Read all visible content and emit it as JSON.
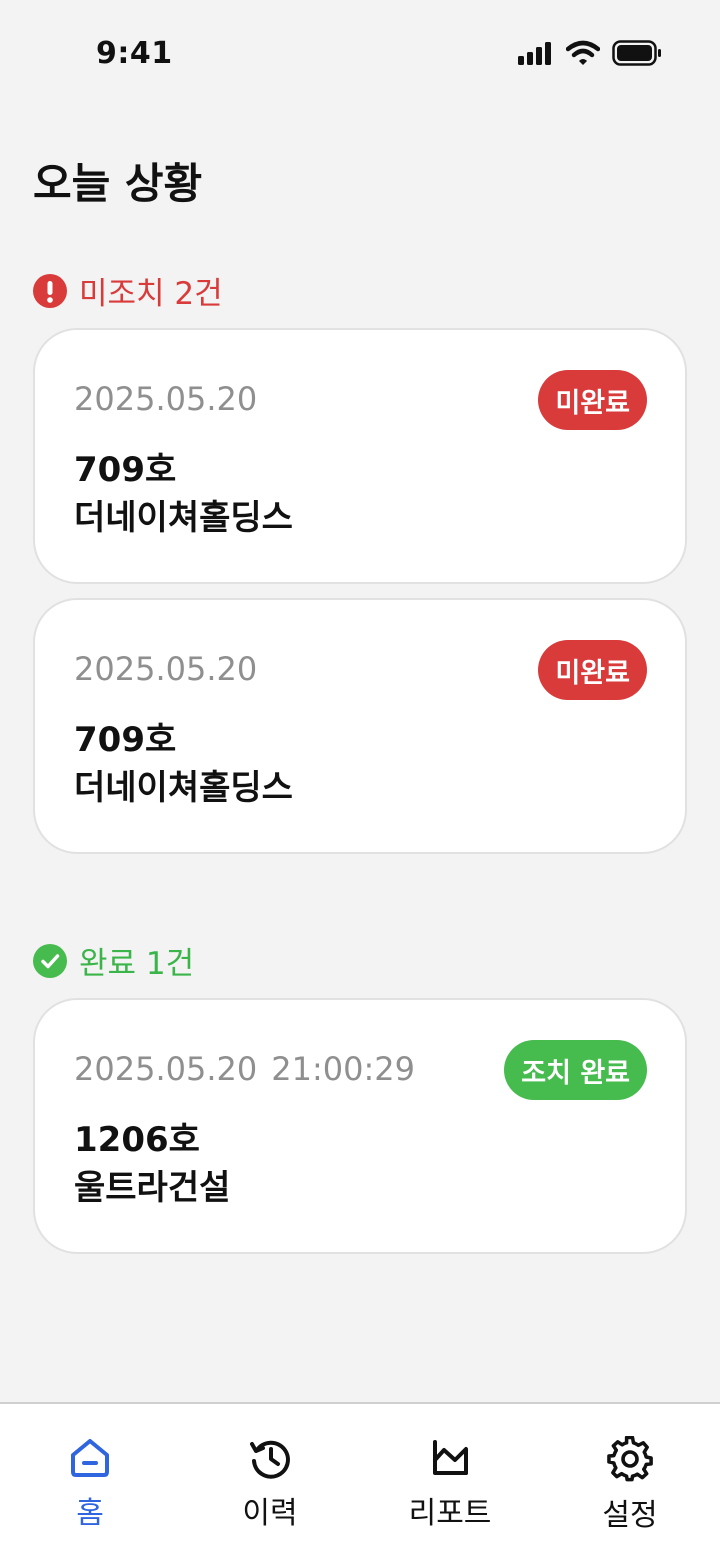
{
  "status_bar": {
    "time": "9:41"
  },
  "page_title": "오늘 상황",
  "pending": {
    "header": "미조치 2건",
    "items": [
      {
        "date": "2025.05.20",
        "room": "709호",
        "company": "더네이쳐홀딩스",
        "badge": "미완료"
      },
      {
        "date": "2025.05.20",
        "room": "709호",
        "company": "더네이쳐홀딩스",
        "badge": "미완료"
      }
    ]
  },
  "done": {
    "header": "완료 1건",
    "items": [
      {
        "date": "2025.05.20",
        "time": "21:00:29",
        "room": "1206호",
        "company": "울트라건설",
        "badge": "조치 완료"
      }
    ]
  },
  "nav": {
    "items": [
      {
        "label": "홈",
        "icon": "home-icon",
        "active": true
      },
      {
        "label": "이력",
        "icon": "history-icon",
        "active": false
      },
      {
        "label": "리포트",
        "icon": "report-icon",
        "active": false
      },
      {
        "label": "설정",
        "icon": "gear-icon",
        "active": false
      }
    ]
  },
  "colors": {
    "alert_red": "#d93a3a",
    "success_green": "#46bb4e",
    "active_blue": "#2f66e0",
    "background": "#f3f3f3"
  }
}
